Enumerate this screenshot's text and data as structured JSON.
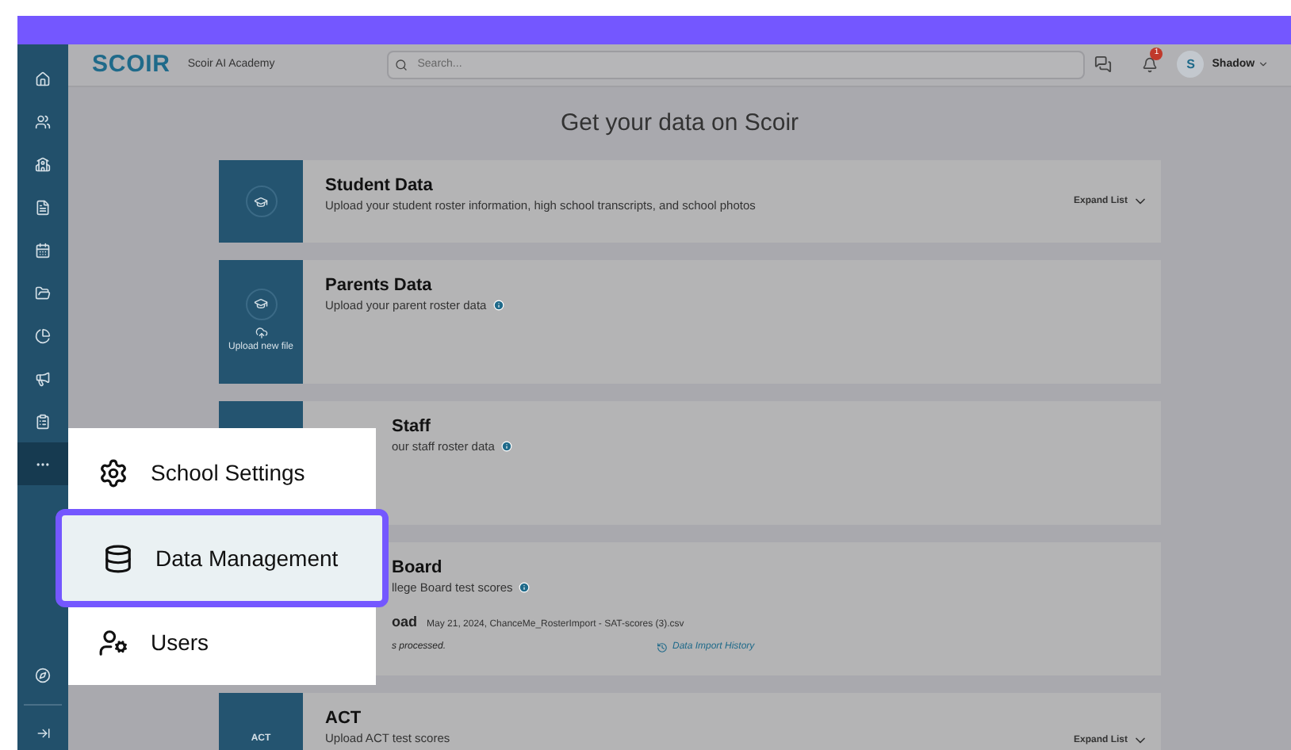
{
  "brand": {
    "logo": "SCOIR",
    "school": "Scoir AI Academy"
  },
  "search": {
    "placeholder": "Search..."
  },
  "notifications": {
    "badge": "1"
  },
  "user": {
    "initial": "S",
    "name": "Shadow"
  },
  "sidebar": {
    "items": [
      {
        "selected": false
      },
      {
        "selected": false
      },
      {
        "selected": false
      },
      {
        "selected": false
      },
      {
        "selected": false
      },
      {
        "selected": false
      },
      {
        "selected": false
      },
      {
        "selected": false
      },
      {
        "selected": false
      },
      {
        "selected": true
      }
    ]
  },
  "page_title": "Get your data on Scoir",
  "cards": [
    {
      "title": "Student Data",
      "description": "Upload your student roster information, high school transcripts, and school photos",
      "info": false,
      "obscured": false,
      "expand": "Expand List"
    },
    {
      "title": "Parents Data",
      "description": "Upload your parent roster data",
      "info": true,
      "obscured": false,
      "upload": "Upload new file"
    },
    {
      "title": "Staff",
      "description": "our staff roster data",
      "info": true,
      "obscured": true
    },
    {
      "title": "Board",
      "description": "llege Board test scores",
      "info": true,
      "obscured": true,
      "last_upload": {
        "label": "oad",
        "detail": "May 21, 2024, ChanceMe_RosterImport - SAT-scores (3).csv",
        "status": "s processed.",
        "history": "Data Import History"
      }
    },
    {
      "title": "ACT",
      "description": "Upload ACT test scores",
      "info": false,
      "obscured": false,
      "badge": "ACT",
      "expand": "Expand List"
    }
  ],
  "menu": {
    "items": [
      {
        "label": "School Settings",
        "selected": false
      },
      {
        "label": "Data Management",
        "selected": true
      },
      {
        "label": "Users",
        "selected": false
      }
    ]
  }
}
